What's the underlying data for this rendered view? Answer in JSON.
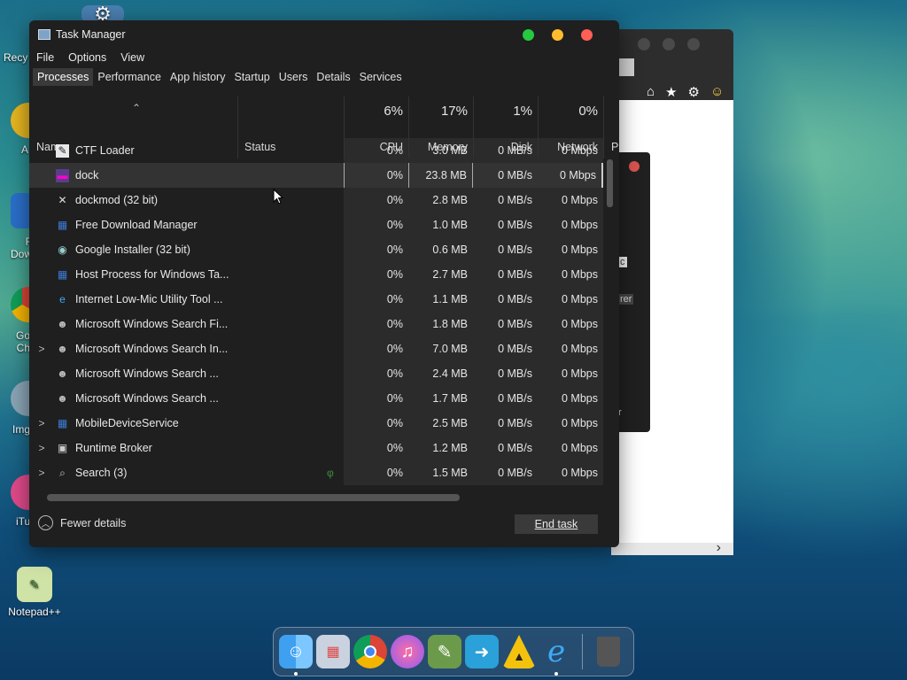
{
  "desktop": {
    "icons": [
      {
        "label": "Recy",
        "glyph": "recycle-bin"
      },
      {
        "label": "A",
        "glyph": "app"
      },
      {
        "label": "F\nDow",
        "glyph": "free-download-manager"
      },
      {
        "label": "Go\nCh",
        "glyph": "chrome"
      },
      {
        "label": "Img",
        "glyph": "image"
      },
      {
        "label": "iTu",
        "glyph": "itunes"
      },
      {
        "label": "Notepad++",
        "glyph": "notepad-plus-plus"
      }
    ],
    "bg_dialog_fragments": [
      "c",
      "rer",
      "r"
    ]
  },
  "task_manager": {
    "title": "Task Manager",
    "menu": [
      "File",
      "Options",
      "View"
    ],
    "tabs": [
      "Processes",
      "Performance",
      "App history",
      "Startup",
      "Users",
      "Details",
      "Services"
    ],
    "active_tab": "Processes",
    "columns": {
      "name": "Name",
      "status": "Status",
      "cpu": {
        "pct": "6%",
        "label": "CPU"
      },
      "memory": {
        "pct": "17%",
        "label": "Memory"
      },
      "disk": {
        "pct": "1%",
        "label": "Disk"
      },
      "network": {
        "pct": "0%",
        "label": "Network"
      },
      "power": "P"
    },
    "rows": [
      {
        "name": "CTF Loader",
        "expand": "",
        "icon": "ctf-loader-icon",
        "cpu": "0%",
        "mem": "3.0 MB",
        "disk": "0 MB/s",
        "net": "0 Mbps",
        "leaf": ""
      },
      {
        "name": "dock",
        "expand": "",
        "icon": "dock-app-icon",
        "cpu": "0%",
        "mem": "23.8 MB",
        "disk": "0 MB/s",
        "net": "0 Mbps",
        "leaf": "",
        "selected": true
      },
      {
        "name": "dockmod (32 bit)",
        "expand": "",
        "icon": "tools-icon",
        "cpu": "0%",
        "mem": "2.8 MB",
        "disk": "0 MB/s",
        "net": "0 Mbps",
        "leaf": ""
      },
      {
        "name": "Free Download Manager",
        "expand": "",
        "icon": "window-grid-icon",
        "cpu": "0%",
        "mem": "1.0 MB",
        "disk": "0 MB/s",
        "net": "0 Mbps",
        "leaf": ""
      },
      {
        "name": "Google Installer (32 bit)",
        "expand": "",
        "icon": "installer-icon",
        "cpu": "0%",
        "mem": "0.6 MB",
        "disk": "0 MB/s",
        "net": "0 Mbps",
        "leaf": ""
      },
      {
        "name": "Host Process for Windows Ta...",
        "expand": "",
        "icon": "window-grid-icon",
        "cpu": "0%",
        "mem": "2.7 MB",
        "disk": "0 MB/s",
        "net": "0 Mbps",
        "leaf": ""
      },
      {
        "name": "Internet Low-Mic Utility Tool ...",
        "expand": "",
        "icon": "internet-explorer-icon",
        "cpu": "0%",
        "mem": "1.1 MB",
        "disk": "0 MB/s",
        "net": "0 Mbps",
        "leaf": ""
      },
      {
        "name": "Microsoft Windows Search Fi...",
        "expand": "",
        "icon": "search-user-icon",
        "cpu": "0%",
        "mem": "1.8 MB",
        "disk": "0 MB/s",
        "net": "0 Mbps",
        "leaf": ""
      },
      {
        "name": "Microsoft Windows Search In...",
        "expand": ">",
        "icon": "search-user-icon",
        "cpu": "0%",
        "mem": "7.0 MB",
        "disk": "0 MB/s",
        "net": "0 Mbps",
        "leaf": ""
      },
      {
        "name": "Microsoft Windows Search ...",
        "expand": "",
        "icon": "search-user-icon",
        "cpu": "0%",
        "mem": "2.4 MB",
        "disk": "0 MB/s",
        "net": "0 Mbps",
        "leaf": ""
      },
      {
        "name": "Microsoft Windows Search ...",
        "expand": "",
        "icon": "search-user-icon",
        "cpu": "0%",
        "mem": "1.7 MB",
        "disk": "0 MB/s",
        "net": "0 Mbps",
        "leaf": ""
      },
      {
        "name": "MobileDeviceService",
        "expand": ">",
        "icon": "window-grid-icon",
        "cpu": "0%",
        "mem": "2.5 MB",
        "disk": "0 MB/s",
        "net": "0 Mbps",
        "leaf": ""
      },
      {
        "name": "Runtime Broker",
        "expand": ">",
        "icon": "runtime-broker-icon",
        "cpu": "0%",
        "mem": "1.2 MB",
        "disk": "0 MB/s",
        "net": "0 Mbps",
        "leaf": ""
      },
      {
        "name": "Search (3)",
        "expand": ">",
        "icon": "search-icon",
        "cpu": "0%",
        "mem": "1.5 MB",
        "disk": "0 MB/s",
        "net": "0 Mbps",
        "leaf": "φ"
      }
    ],
    "footer": {
      "fewer_details": "Fewer details",
      "end_task": "End task"
    }
  },
  "dock": {
    "items": [
      "finder",
      "launchpad",
      "chrome",
      "itunes",
      "image-viewer",
      "migration",
      "artemis",
      "internet-explorer",
      "trash"
    ]
  },
  "colors": {
    "traffic_green": "#27c93f",
    "traffic_yellow": "#ffbd2e",
    "traffic_red": "#ff5f56"
  }
}
